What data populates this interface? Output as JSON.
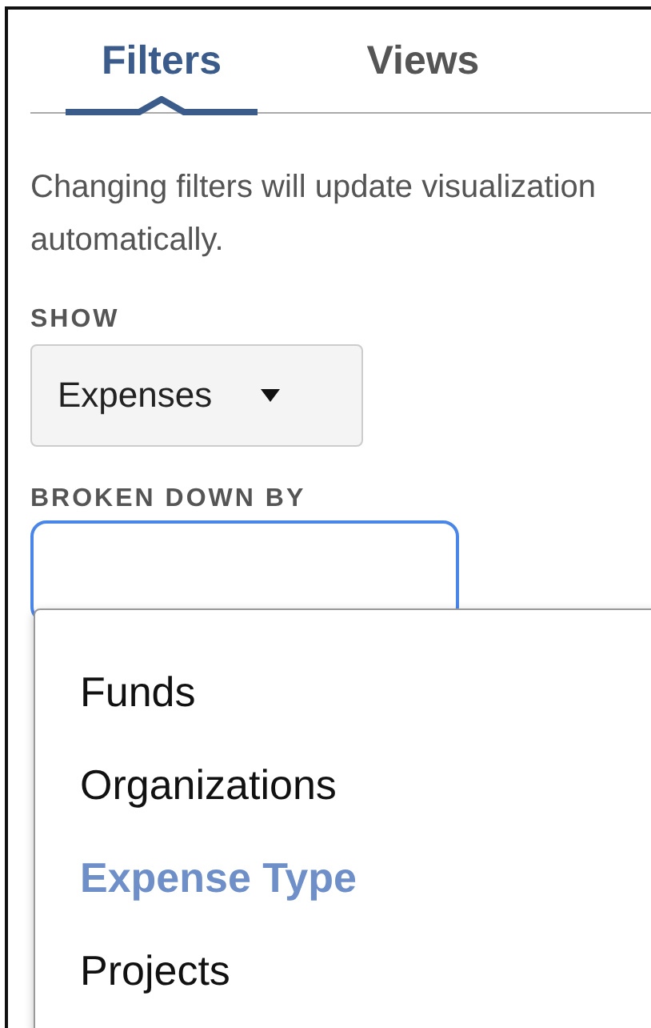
{
  "tabs": [
    {
      "label": "Filters",
      "selected": true
    },
    {
      "label": "Views",
      "selected": false
    }
  ],
  "description": "Changing filters will update visualization automatically.",
  "show": {
    "label": "SHOW",
    "value": "Expenses"
  },
  "broken_down_by": {
    "label": "BROKEN DOWN BY",
    "focused": true,
    "options": [
      {
        "label": "Funds",
        "selected": false
      },
      {
        "label": "Organizations",
        "selected": false
      },
      {
        "label": "Expense Type",
        "selected": true
      },
      {
        "label": "Projects",
        "selected": false
      }
    ]
  }
}
